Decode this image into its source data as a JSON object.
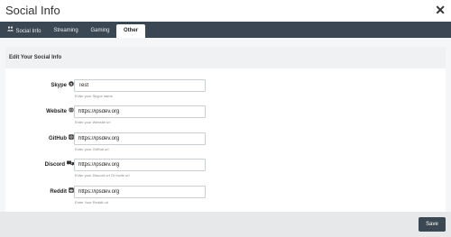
{
  "modal": {
    "title": "Social Info",
    "close_glyph": "✕"
  },
  "tabs": [
    {
      "label": "Social Info",
      "icon": "users-icon"
    },
    {
      "label": "Streaming"
    },
    {
      "label": "Gaming"
    },
    {
      "label": "Other",
      "active": true
    }
  ],
  "section": {
    "title": "Edit Your Social Info"
  },
  "fields": [
    {
      "label": "Skype",
      "icon": "skype-icon",
      "value": "Test",
      "hint": "Enter your Skype name"
    },
    {
      "label": "Website",
      "icon": "globe-icon",
      "value": "https://ipsdev.org",
      "hint": "Enter your Website url"
    },
    {
      "label": "GitHub",
      "icon": "github-icon",
      "value": "https://ipsdev.org",
      "hint": "Enter your GitHub url"
    },
    {
      "label": "Discord",
      "icon": "discord-icon",
      "value": "https://ipsdev.org",
      "hint": "Enter your Discord url Or Invite url"
    },
    {
      "label": "Reddit",
      "icon": "reddit-icon",
      "value": "https://ipsdev.org",
      "hint": "Enter Your Reddit url"
    }
  ],
  "footer": {
    "save_label": "Save"
  },
  "colors": {
    "tabbar": "#3b4752",
    "accent": "#3b4752",
    "footer": "#e7e8ea"
  }
}
